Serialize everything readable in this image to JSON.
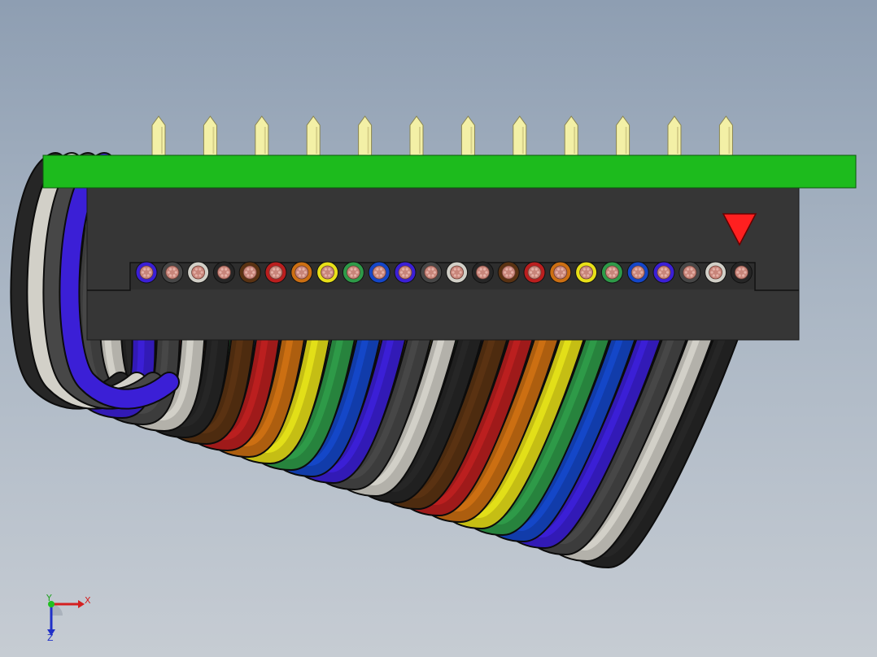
{
  "scene": {
    "background_top": "#8e9eb2",
    "background_bottom": "#c6ccd3",
    "pcb_color": "#1dbb1d",
    "connector_color": "#363636",
    "pin_color": "#f3f0a6",
    "marker_color": "#ff2020",
    "pin_count": 12,
    "wire_colors": [
      "#3b1fd6",
      "#474747",
      "#d2d0c8",
      "#262626",
      "#5a3212",
      "#bb1e1e",
      "#cc6f12",
      "#e8e018",
      "#2e9a48",
      "#1446c8",
      "#3b1fd6",
      "#474747",
      "#d2d0c8",
      "#262626",
      "#5a3212",
      "#bb1e1e",
      "#cc6f12",
      "#e8e018",
      "#2e9a48",
      "#1446c8",
      "#3b1fd6",
      "#474747",
      "#d2d0c8",
      "#262626"
    ]
  },
  "triad": {
    "x_label": "X",
    "y_label": "Y",
    "z_label": "Z",
    "icon": "coordinate-triad-icon"
  }
}
